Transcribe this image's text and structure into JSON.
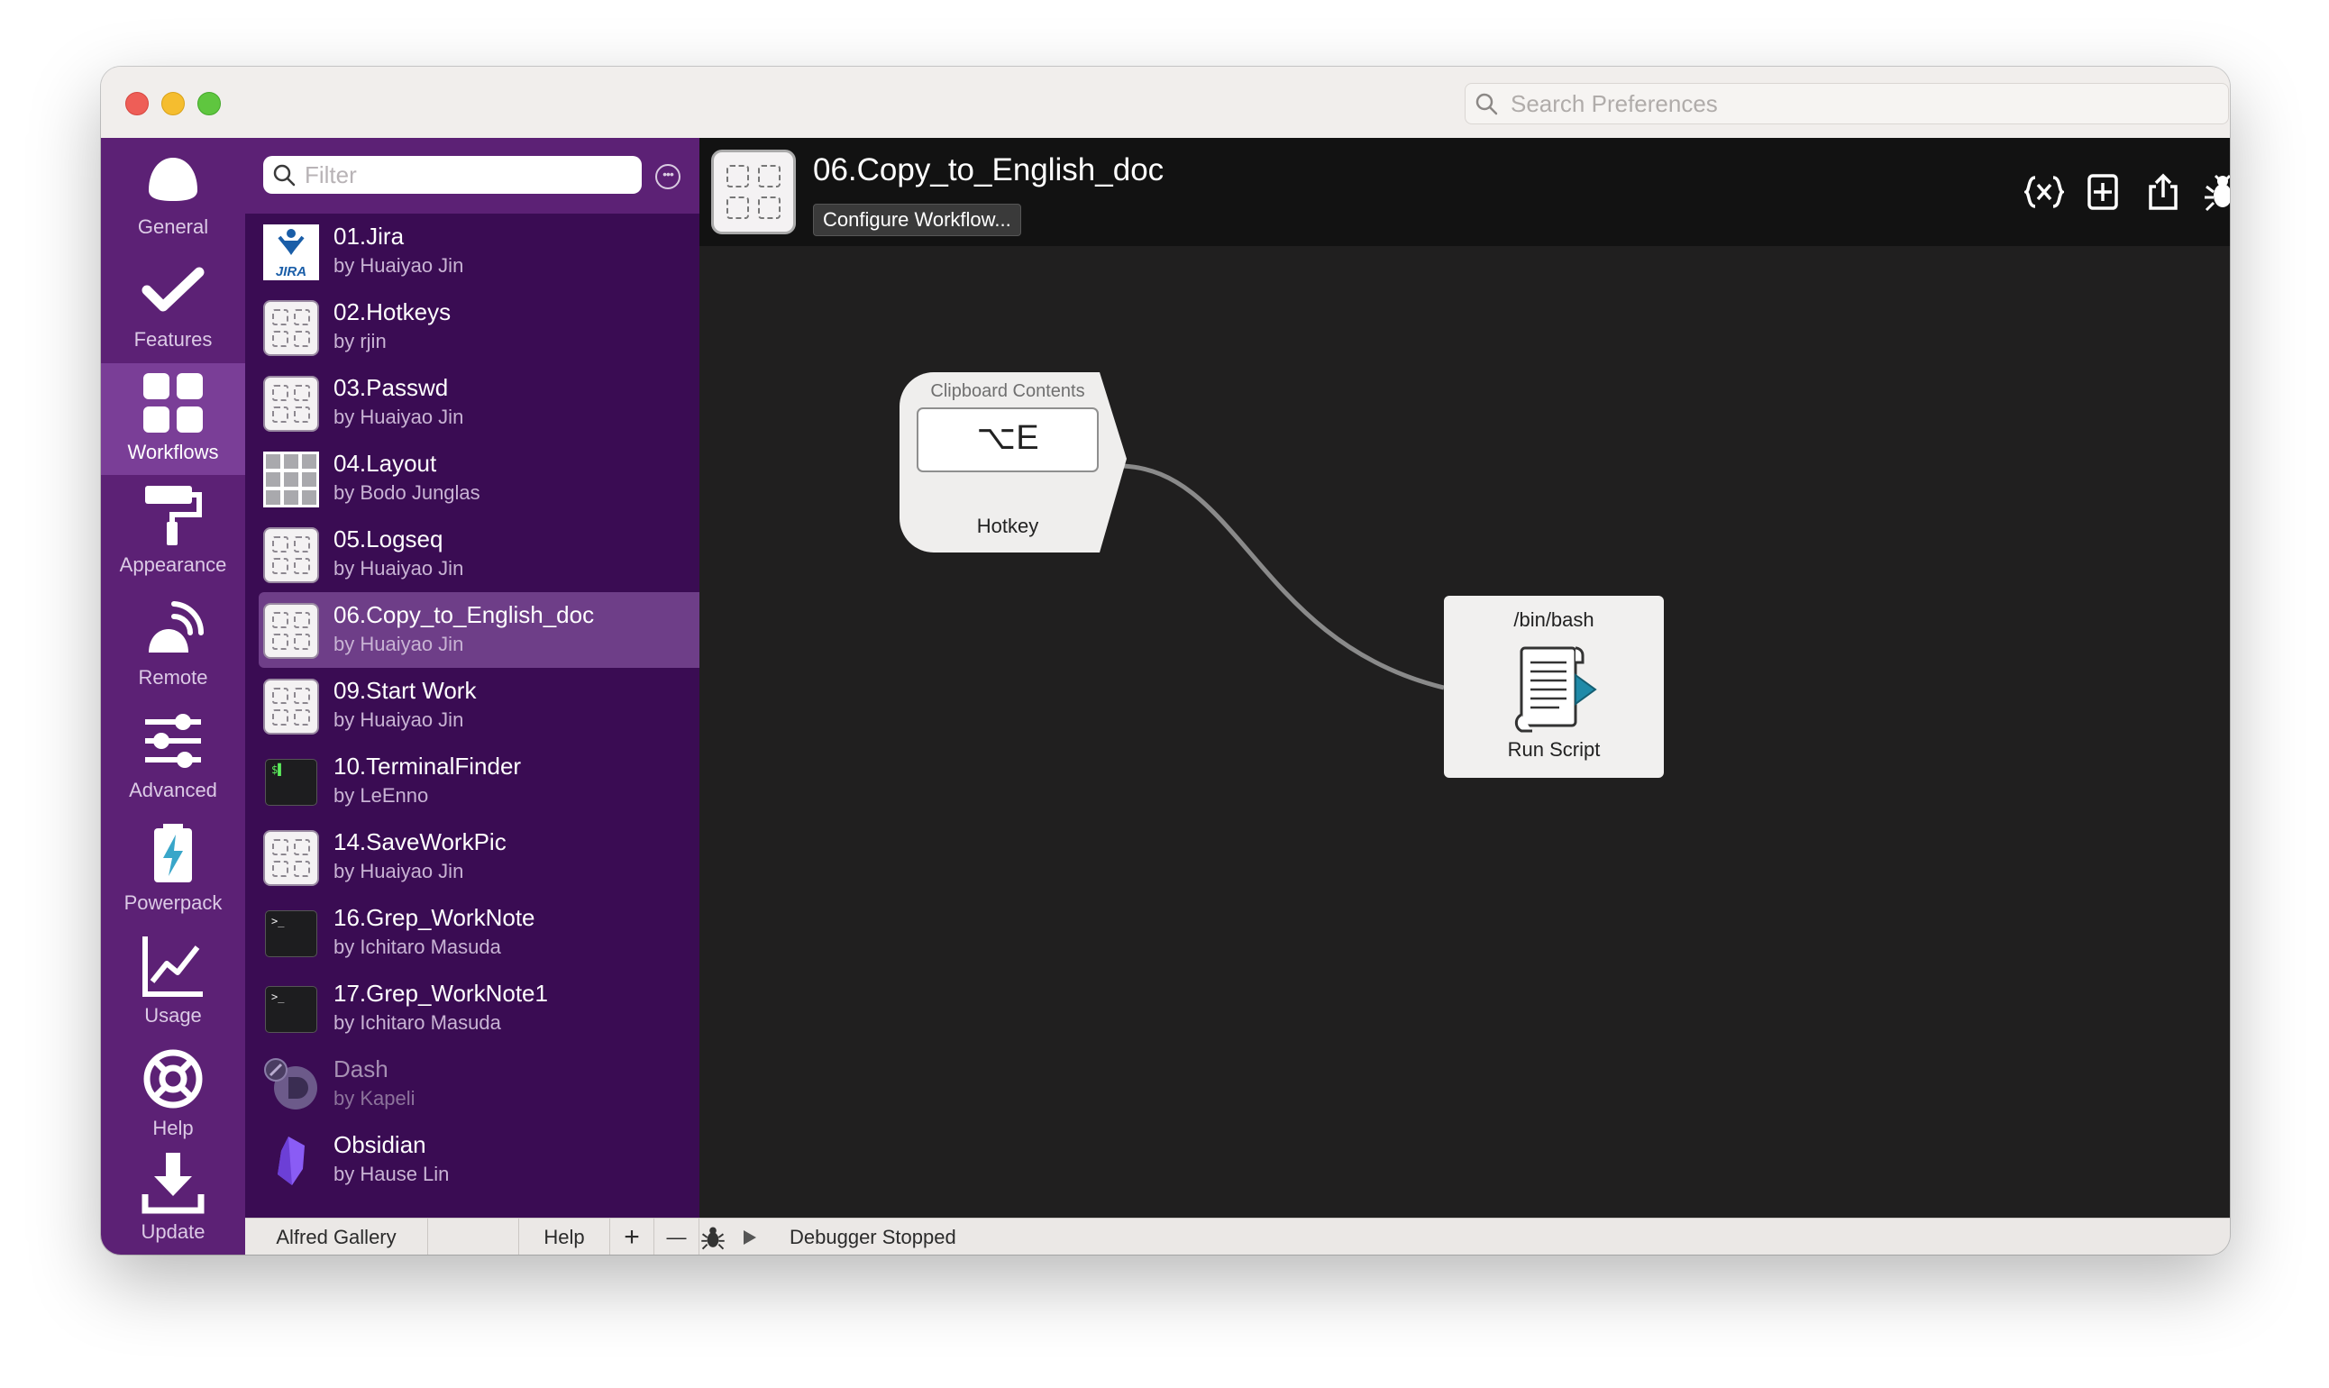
{
  "search_preferences": {
    "placeholder": "Search Preferences"
  },
  "nav": {
    "items": [
      {
        "label": "General",
        "icon": "hat-icon"
      },
      {
        "label": "Features",
        "icon": "checkmark-icon"
      },
      {
        "label": "Workflows",
        "icon": "grid-icon",
        "active": true
      },
      {
        "label": "Appearance",
        "icon": "paint-roller-icon"
      },
      {
        "label": "Remote",
        "icon": "remote-icon"
      },
      {
        "label": "Advanced",
        "icon": "sliders-icon"
      },
      {
        "label": "Powerpack",
        "icon": "battery-bolt-icon"
      },
      {
        "label": "Usage",
        "icon": "chart-icon"
      },
      {
        "label": "Help",
        "icon": "lifebuoy-icon"
      },
      {
        "label": "Update",
        "icon": "download-icon"
      }
    ]
  },
  "list": {
    "filter_placeholder": "Filter",
    "workflows": [
      {
        "title": "01.Jira",
        "author": "by Huaiyao Jin",
        "icon": "jira-icon",
        "icon_text": "JIRA"
      },
      {
        "title": "02.Hotkeys",
        "author": "by rjin",
        "icon": "generic-workflow-icon"
      },
      {
        "title": "03.Passwd",
        "author": "by Huaiyao Jin",
        "icon": "generic-workflow-icon"
      },
      {
        "title": "04.Layout",
        "author": "by Bodo Junglas",
        "icon": "layout-grid-icon"
      },
      {
        "title": "05.Logseq",
        "author": "by Huaiyao Jin",
        "icon": "generic-workflow-icon"
      },
      {
        "title": "06.Copy_to_English_doc",
        "author": "by Huaiyao Jin",
        "icon": "generic-workflow-icon",
        "selected": true
      },
      {
        "title": "09.Start Work",
        "author": "by Huaiyao Jin",
        "icon": "generic-workflow-icon"
      },
      {
        "title": "10.TerminalFinder",
        "author": "by LeEnno",
        "icon": "terminal-icon",
        "icon_text": "$▌"
      },
      {
        "title": "14.SaveWorkPic",
        "author": "by Huaiyao Jin",
        "icon": "generic-workflow-icon"
      },
      {
        "title": "16.Grep_WorkNote",
        "author": "by Ichitaro Masuda",
        "icon": "terminal-icon",
        "icon_text": ">_"
      },
      {
        "title": "17.Grep_WorkNote1",
        "author": "by Ichitaro Masuda",
        "icon": "terminal-icon",
        "icon_text": ">_"
      },
      {
        "title": "Dash",
        "author": "by Kapeli",
        "icon": "dash-icon",
        "disabled": true
      },
      {
        "title": "Obsidian",
        "author": "by Hause Lin",
        "icon": "obsidian-icon"
      }
    ]
  },
  "bottom_bar": {
    "gallery_label": "Alfred Gallery",
    "help_label": "Help",
    "add_label": "+",
    "remove_label": "—",
    "debugger_status": "Debugger Stopped"
  },
  "editor": {
    "workflow_title": "06.Copy_to_English_doc",
    "configure_label": "Configure Workflow...",
    "toolbar_icons": [
      "variables-icon",
      "add-object-icon",
      "share-icon",
      "debug-bug-icon",
      "menu-lines-icon"
    ],
    "hotkey_node": {
      "header": "Clipboard Contents",
      "shortcut": "⌥E",
      "label": "Hotkey"
    },
    "run_script_node": {
      "header": "/bin/bash",
      "label": "Run Script"
    }
  },
  "colors": {
    "nav_bg": "#5c2175",
    "list_bg": "#3a0c53",
    "selected_row": "#6e3e88",
    "editor_bg": "#201f1f"
  }
}
